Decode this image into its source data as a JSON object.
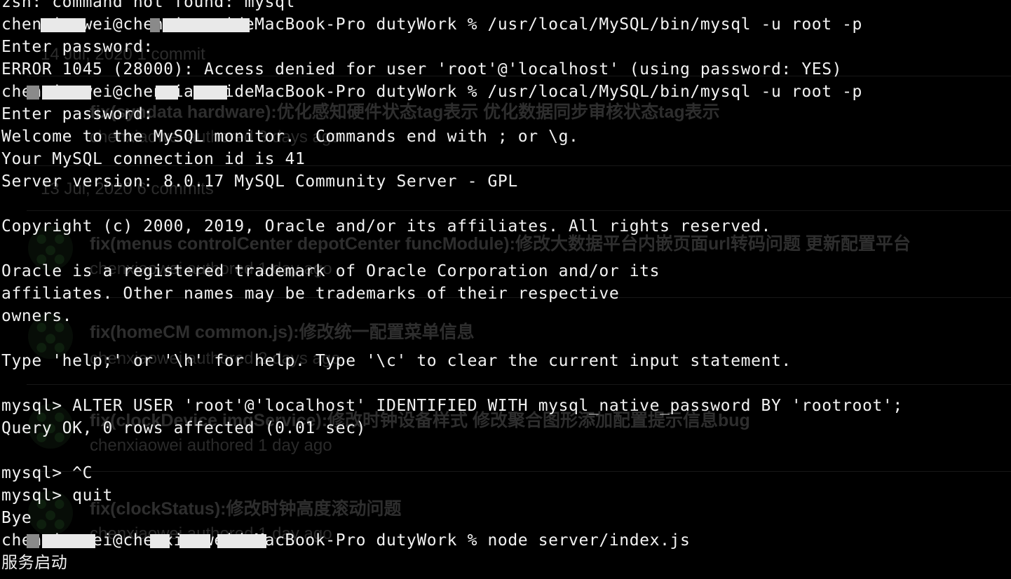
{
  "terminal": {
    "lines": [
      "zsh: command not found: mysql",
      "chenxiaowei@chenxiaoweideMacBook-Pro dutyWork % /usr/local/MySQL/bin/mysql -u root -p",
      "Enter password:",
      "ERROR 1045 (28000): Access denied for user 'root'@'localhost' (using password: YES)",
      "chenxiaowei@chenxiaoweideMacBook-Pro dutyWork % /usr/local/MySQL/bin/mysql -u root -p",
      "Enter password:",
      "Welcome to the MySQL monitor.  Commands end with ; or \\g.",
      "Your MySQL connection id is 41",
      "Server version: 8.0.17 MySQL Community Server - GPL",
      "",
      "Copyright (c) 2000, 2019, Oracle and/or its affiliates. All rights reserved.",
      "",
      "Oracle is a registered trademark of Oracle Corporation and/or its",
      "affiliates. Other names may be trademarks of their respective",
      "owners.",
      "",
      "Type 'help;' or '\\h' for help. Type '\\c' to clear the current input statement.",
      "",
      "mysql> ALTER USER 'root'@'localhost' IDENTIFIED WITH mysql_native_password BY 'rootroot';",
      "Query OK, 0 rows affected (0.01 sec)",
      "",
      "mysql> ^C",
      "mysql> quit",
      "Bye",
      "chenxiaowei@chenxiaoweideMacBook-Pro dutyWork % node server/index.js",
      "服务启动"
    ]
  },
  "background": {
    "dates": [
      "14 Jul, 2020 1 commit",
      "13 Jul, 2020 6 commits"
    ],
    "commits": [
      {
        "title": "fix(syndata hardware):优化感知硬件状态tag表示 优化数据同步审核状态tag表示",
        "sub": "chenxiaowei authored 3 days ago"
      },
      {
        "title": "fix(menus controlCenter depotCenter funcModule):修改大数据平台内嵌页面url转码问题 更新配置平台",
        "sub": "chenxiaowei authored 1 day ago"
      },
      {
        "title": "fix(homeCM common.js):修改统一配置菜单信息",
        "sub": "chenxiaowei authored 2 days ago"
      },
      {
        "title": "fix(clockDevice imgService):修改时钟设备样式 修改聚合图形添加配置提示信息bug",
        "sub": "chenxiaowei authored 1 day ago"
      },
      {
        "title": "fix(clockStatus):修改时钟高度滚动问题",
        "sub": "chenxiaowei authored 1 day ago"
      }
    ]
  }
}
